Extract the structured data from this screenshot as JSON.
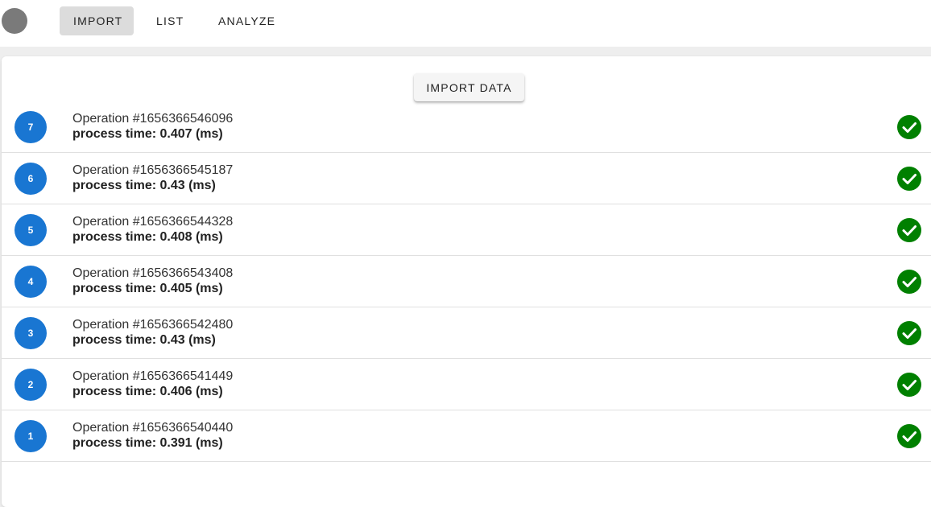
{
  "nav": {
    "tabs": [
      {
        "label": "IMPORT",
        "active": true
      },
      {
        "label": "LIST",
        "active": false
      },
      {
        "label": "ANALYZE",
        "active": false
      }
    ]
  },
  "main": {
    "import_button_label": "IMPORT DATA",
    "operations": [
      {
        "index": "7",
        "name": "Operation #1656366546096",
        "process_time": "process time: 0.407 (ms)",
        "status": "success"
      },
      {
        "index": "6",
        "name": "Operation #1656366545187",
        "process_time": "process time: 0.43 (ms)",
        "status": "success"
      },
      {
        "index": "5",
        "name": "Operation #1656366544328",
        "process_time": "process time: 0.408 (ms)",
        "status": "success"
      },
      {
        "index": "4",
        "name": "Operation #1656366543408",
        "process_time": "process time: 0.405 (ms)",
        "status": "success"
      },
      {
        "index": "3",
        "name": "Operation #1656366542480",
        "process_time": "process time: 0.43 (ms)",
        "status": "success"
      },
      {
        "index": "2",
        "name": "Operation #1656366541449",
        "process_time": "process time: 0.406 (ms)",
        "status": "success"
      },
      {
        "index": "1",
        "name": "Operation #1656366540440",
        "process_time": "process time: 0.391 (ms)",
        "status": "success"
      }
    ]
  },
  "icons": {
    "avatar": "avatar",
    "status_success": "check-circle-icon"
  },
  "colors": {
    "badge": "#1976d2",
    "success": "#008000",
    "active_tab": "#dcdcdc"
  }
}
